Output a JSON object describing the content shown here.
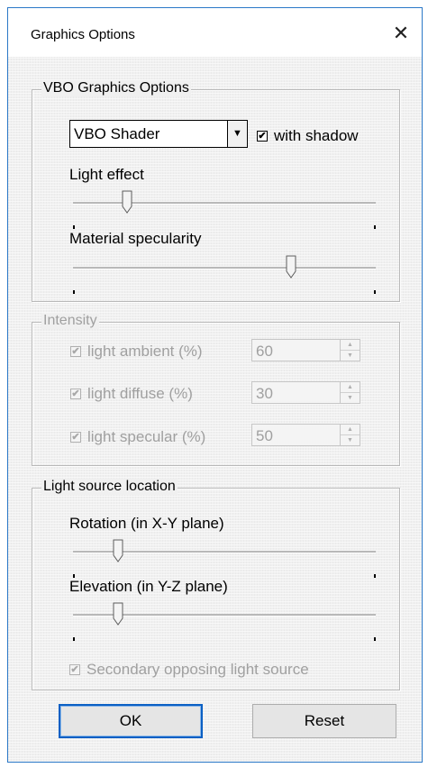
{
  "dialog": {
    "title": "Graphics Options",
    "close_glyph": "✕"
  },
  "vbo": {
    "group_label": "VBO Graphics Options",
    "shader": {
      "selected": "VBO Shader",
      "arrow": "▼"
    },
    "with_shadow": {
      "label": "with shadow",
      "checked": true,
      "mark": "✔"
    },
    "light_effect": {
      "label": "Light effect",
      "level": 0.18
    },
    "material_specularity": {
      "label": "Material specularity",
      "level": 0.72
    }
  },
  "intensity": {
    "group_label": "Intensity",
    "disabled": true,
    "rows": [
      {
        "label": "light ambient (%)",
        "value": "60",
        "checked": true
      },
      {
        "label": "light diffuse (%)",
        "value": "30",
        "checked": true
      },
      {
        "label": "light specular (%)",
        "value": "50",
        "checked": true
      }
    ],
    "check_mark": "✔",
    "spin_up": "▲",
    "spin_down": "▼"
  },
  "light_source": {
    "group_label": "Light source location",
    "rotation": {
      "label": "Rotation (in X-Y plane)",
      "level": 0.15
    },
    "elevation": {
      "label": "Elevation (in Y-Z plane)",
      "level": 0.15
    },
    "secondary": {
      "label": "Secondary opposing light source",
      "checked": true,
      "disabled": true,
      "mark": "✔"
    }
  },
  "buttons": {
    "ok": "OK",
    "reset": "Reset"
  },
  "colors": {
    "frame_border": "#2b78c7",
    "default_button_border": "#0a5fc4",
    "disabled_text": "#a0a0a0"
  }
}
